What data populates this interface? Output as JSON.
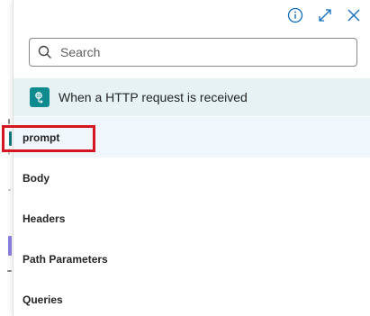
{
  "panel": {
    "search": {
      "placeholder": "Search",
      "value": ""
    },
    "trigger": {
      "label": "When a HTTP request is received",
      "icon": "http-request-icon",
      "color": "#0f8a8e"
    },
    "items": [
      {
        "label": "prompt",
        "selected": true
      },
      {
        "label": "Body"
      },
      {
        "label": "Headers"
      },
      {
        "label": "Path Parameters"
      },
      {
        "label": "Queries"
      }
    ]
  },
  "colors": {
    "accent": "#0f6cbd",
    "highlight": "#d5151f",
    "trigger_bg": "#e6f2f3"
  }
}
